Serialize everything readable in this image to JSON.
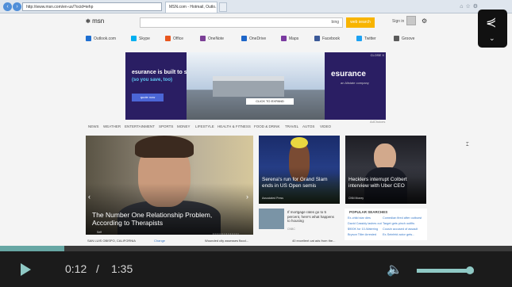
{
  "browser": {
    "address": "http://www.msn.com/en-us/?ocid=iehp",
    "tab_title": "MSN.com - Hotmail, Outlo...",
    "back_icon": "back-arrow-icon",
    "forward_icon": "forward-arrow-icon"
  },
  "header": {
    "logo": "msn",
    "search_placeholder": "",
    "bing_label": "bing",
    "web_search_label": "web search",
    "signin_label": "Sign in"
  },
  "services": [
    {
      "label": "Outlook.com",
      "color": "#1e6fd1"
    },
    {
      "label": "Skype",
      "color": "#00aff0"
    },
    {
      "label": "Office",
      "color": "#e8561e"
    },
    {
      "label": "OneNote",
      "color": "#7b3f96"
    },
    {
      "label": "OneDrive",
      "color": "#1d66c9"
    },
    {
      "label": "Maps",
      "color": "#7a3aa0"
    },
    {
      "label": "Facebook",
      "color": "#3b5998"
    },
    {
      "label": "Twitter",
      "color": "#1da1f2"
    },
    {
      "label": "Groove",
      "color": "#5a5a5a"
    }
  ],
  "ad": {
    "headline": "esurance is built to save",
    "subline": "(so you save, too)",
    "button": "quote now",
    "brand": "esurance",
    "brand_sub": "an Allstate company",
    "cta": "CLICK TO EXPAND",
    "close": "CLOSE X",
    "adchoices": "AdChoices"
  },
  "categories": [
    "NEWS",
    "WEATHER",
    "ENTERTAINMENT",
    "SPORTS",
    "MONEY",
    "LIFESTYLE",
    "HEALTH & FITNESS",
    "FOOD & DRINK",
    "TRAVEL",
    "AUTOS",
    "VIDEO"
  ],
  "hero": {
    "title": "The Number One Relationship Problem, According to Therapists",
    "source": "Self"
  },
  "cards": [
    {
      "title": "Serena's run for Grand Slam ends in US Open semis",
      "source": "Associated Press"
    },
    {
      "title": "Hecklers interrupt Colbert interview with Uber CEO",
      "source": "CNN Money"
    }
  ],
  "small_stories": [
    {
      "text": "If mortgage rates go to 5 percent, here's what happens to housing",
      "source": "CNBC"
    }
  ],
  "popular": {
    "heading": "POPULAR SEARCHES",
    "items": [
      "Ex-child star dies",
      "Comedian fired after outburst",
      "David Cassidy lashes out",
      "Target gets pinch outfits",
      "$900K for 10-Watering",
      "Cousin accused of assault",
      "Bryson Tiller Arrested",
      "Ex-Seinfeld actor gets..."
    ]
  },
  "bottom": {
    "location": "SAN LUIS OBISPO, CALIFORNIA",
    "change": "Change",
    "story": "Wounded city assesses flood...",
    "story2": "40 excellent cat ads from the..."
  },
  "player": {
    "current_time": "0:12",
    "separator": "/",
    "duration": "1:35",
    "progress_fraction": 0.126,
    "volume_fraction": 0.93,
    "play_icon": "play-icon",
    "volume_icon": "volume-icon",
    "share_icon": "share-icon"
  }
}
